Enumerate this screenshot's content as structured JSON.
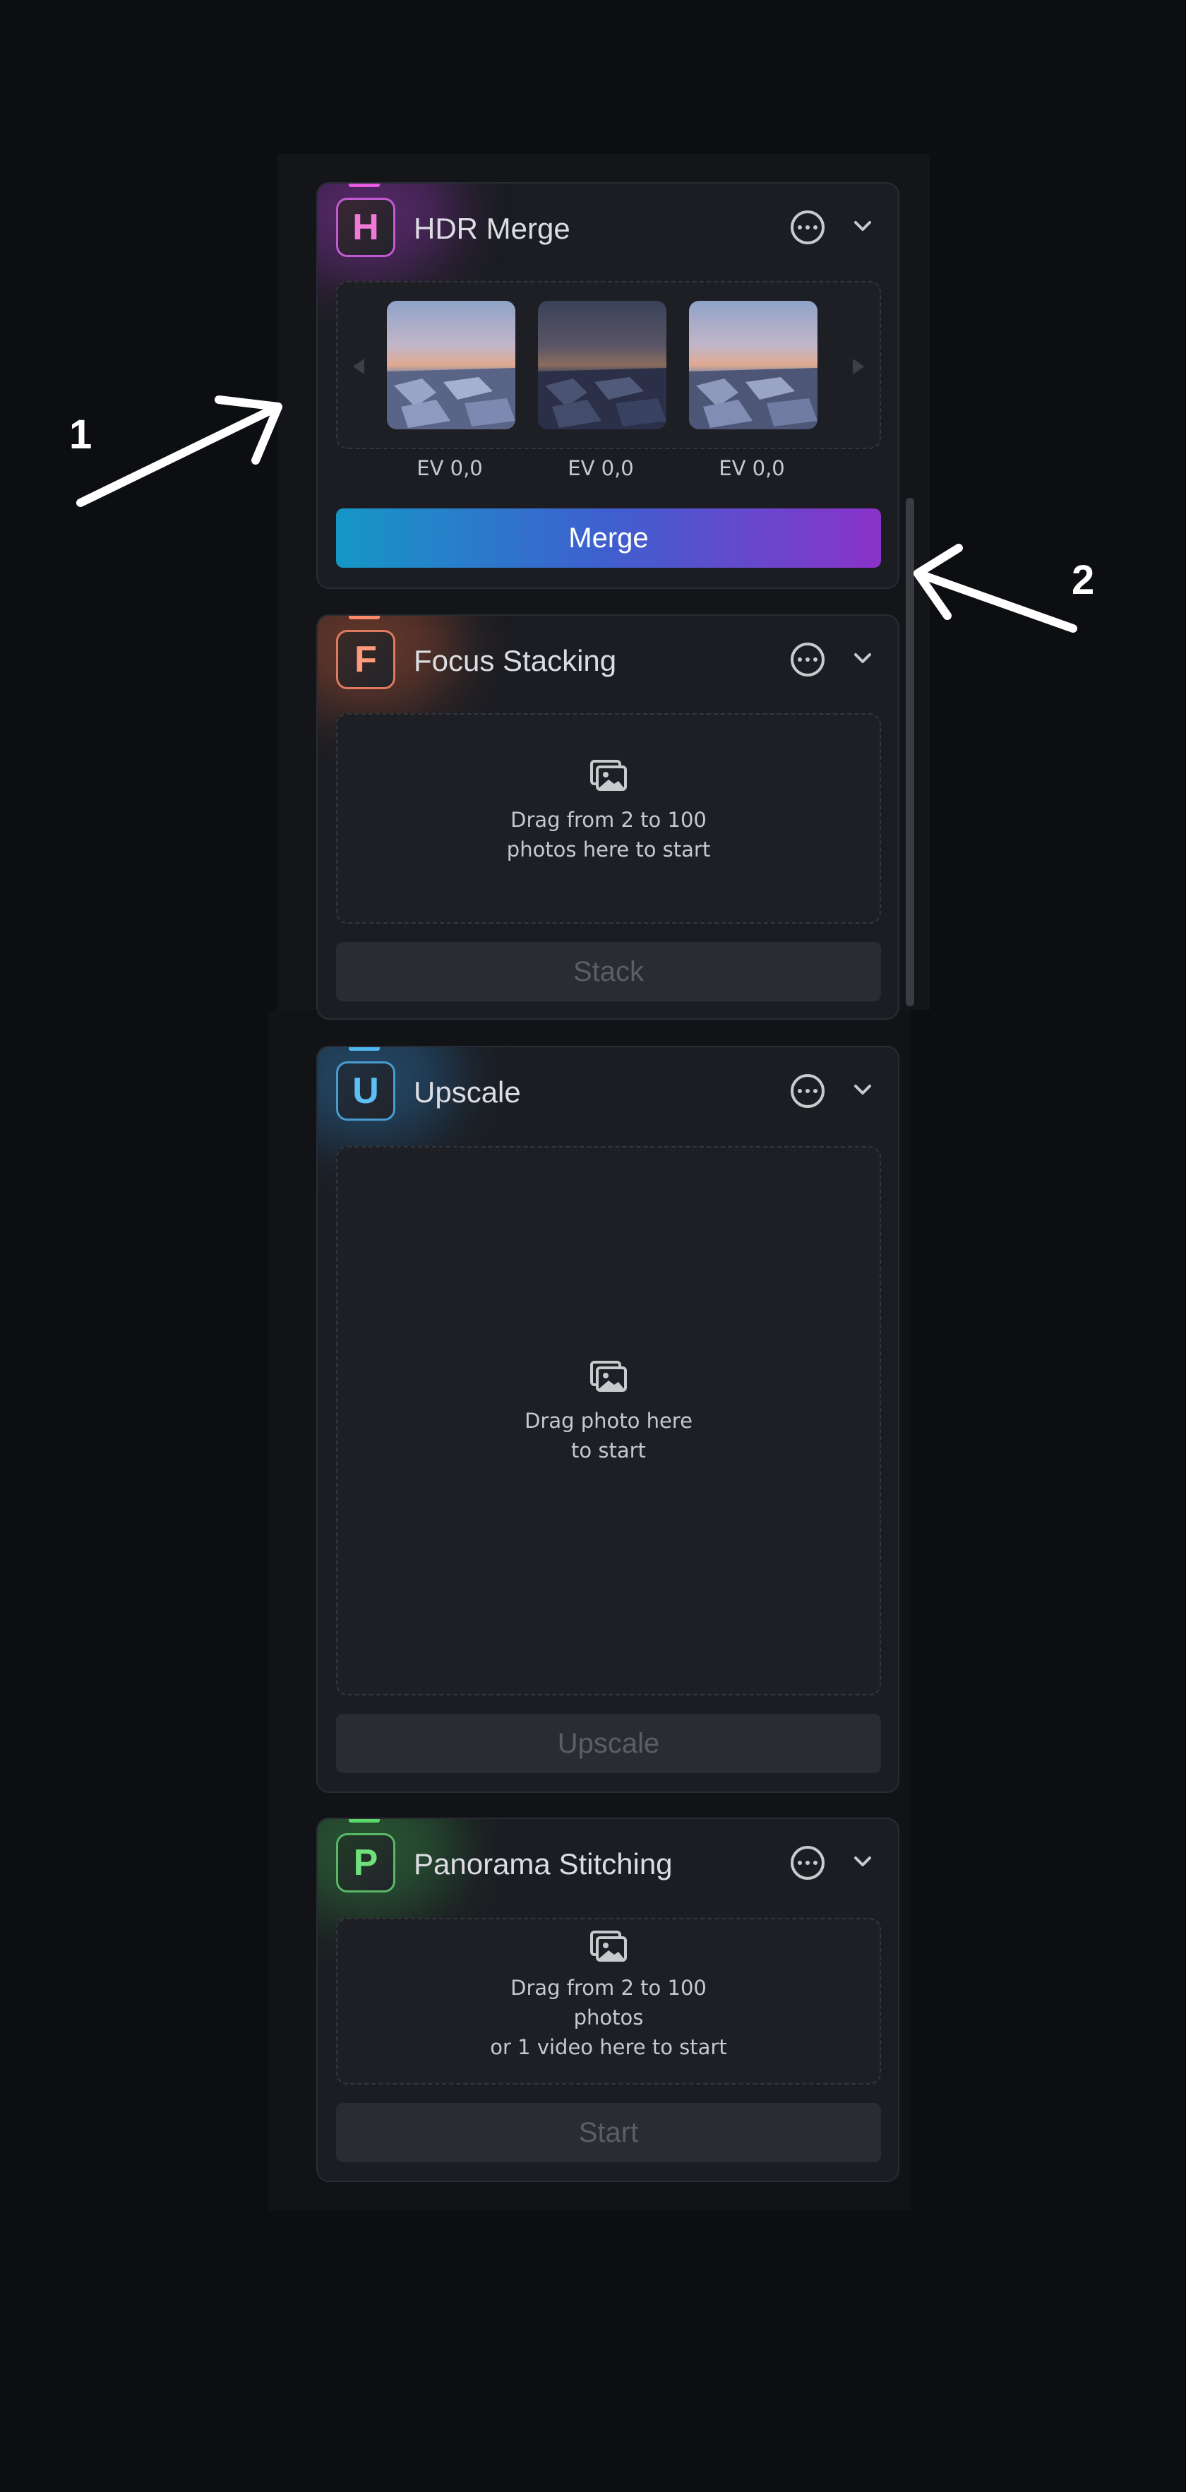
{
  "colors": {
    "page_background": "#0c0e12",
    "card_background": "#1b1d22",
    "hdr_accent": "#e45be0",
    "focus_accent": "#ff8a6a",
    "upscale_accent": "#4fb7f0",
    "panorama_accent": "#5ad86a",
    "merge_gradient_start": "#1597c6",
    "merge_gradient_end": "#8a33c9"
  },
  "annotations": [
    {
      "number": "1",
      "icon": "arrow-icon"
    },
    {
      "number": "2",
      "icon": "arrow-icon"
    }
  ],
  "cards": {
    "hdr_merge": {
      "badge_letter": "H",
      "title": "HDR Merge",
      "more_icon": "more-icon",
      "collapse_icon": "chevron-down-icon",
      "thumbnails": [
        {
          "ev_label": "EV 0,0",
          "image": "frozen-lake-sunset"
        },
        {
          "ev_label": "EV 0,0",
          "image": "frozen-lake-sunset-dark"
        },
        {
          "ev_label": "EV 0,0",
          "image": "frozen-lake-sunset"
        }
      ],
      "prev_icon": "chevron-left-icon",
      "next_icon": "chevron-right-icon",
      "button_label": "Merge"
    },
    "focus_stacking": {
      "badge_letter": "F",
      "title": "Focus Stacking",
      "drop_icon": "photos-icon",
      "drop_text_line1": "Drag from 2 to 100",
      "drop_text_line2": "photos here to start",
      "button_label": "Stack"
    },
    "upscale": {
      "badge_letter": "U",
      "title": "Upscale",
      "drop_icon": "photos-icon",
      "drop_text_line1": "Drag photo here",
      "drop_text_line2": "to start",
      "button_label": "Upscale"
    },
    "panorama": {
      "badge_letter": "P",
      "title": "Panorama Stitching",
      "drop_icon": "photos-icon",
      "drop_text_line1": "Drag from 2 to 100",
      "drop_text_line2": "photos",
      "drop_text_line3": "or 1 video here to start",
      "button_label": "Start"
    }
  }
}
